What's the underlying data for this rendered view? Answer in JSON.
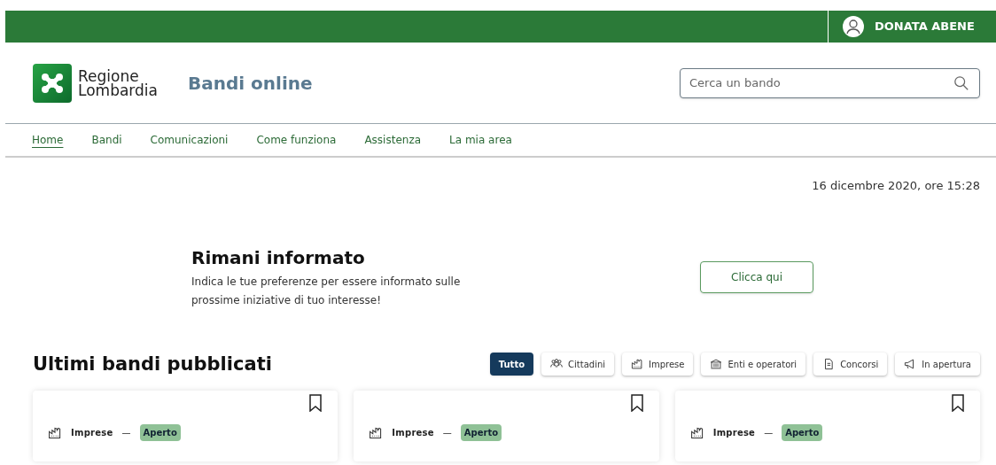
{
  "top_bar": {
    "user": "DONATA ABENE"
  },
  "header": {
    "logo_line_1": "Regione",
    "logo_line_2": "Lombardia",
    "site_title": "Bandi online",
    "search": {
      "placeholder": "Cerca un bando"
    }
  },
  "nav": [
    {
      "label": "Home",
      "selected": true
    },
    {
      "label": "Bandi",
      "selected": false
    },
    {
      "label": "Comunicazioni",
      "selected": false
    },
    {
      "label": "Come funziona",
      "selected": false
    },
    {
      "label": "Assistenza",
      "selected": false
    },
    {
      "label": "La mia area",
      "selected": false
    }
  ],
  "date": "16 dicembre 2020, ore 15:28",
  "banner": {
    "title": "Rimani informato",
    "text": "Indica le tue preferenze per essere informato sulle prossime iniziative di tuo interesse!",
    "button": "Clicca qui"
  },
  "section": {
    "title": "Ultimi bandi pubblicati",
    "filters": [
      {
        "label": "Tutto",
        "kind": "none",
        "selected": true
      },
      {
        "label": "Cittadini",
        "kind": "people",
        "selected": false
      },
      {
        "label": "Imprese",
        "kind": "factory",
        "selected": false
      },
      {
        "label": "Enti e operatori",
        "kind": "building",
        "selected": false
      },
      {
        "label": "Concorsi",
        "kind": "document",
        "selected": false
      },
      {
        "label": "In apertura",
        "kind": "megaphone",
        "selected": false
      }
    ],
    "cards": [
      {
        "category": "Imprese",
        "separator": "—",
        "status": "Aperto"
      },
      {
        "category": "Imprese",
        "separator": "—",
        "status": "Aperto"
      },
      {
        "category": "Imprese",
        "separator": "—",
        "status": "Aperto"
      }
    ]
  }
}
